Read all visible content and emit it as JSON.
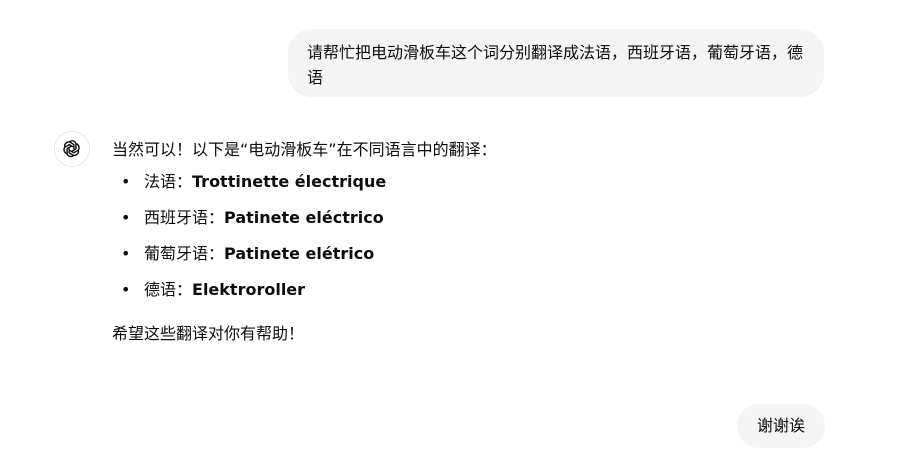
{
  "conversation": {
    "user_message_1": "请帮忙把电动滑板车这个词分别翻译成法语，西班牙语，葡萄牙语，德语",
    "assistant": {
      "avatar_icon": "openai-logo-icon",
      "intro": "当然可以！以下是“电动滑板车”在不同语言中的翻译：",
      "translations": [
        {
          "language": "法语：",
          "term": "Trottinette électrique"
        },
        {
          "language": "西班牙语：",
          "term": "Patinete eléctrico"
        },
        {
          "language": "葡萄牙语：",
          "term": "Patinete elétrico"
        },
        {
          "language": "德语：",
          "term": "Elektroroller"
        }
      ],
      "closing": "希望这些翻译对你有帮助！"
    },
    "user_message_2": "谢谢诶"
  },
  "colors": {
    "bubble_background": "#f4f4f4",
    "text": "#0d0d0d"
  }
}
